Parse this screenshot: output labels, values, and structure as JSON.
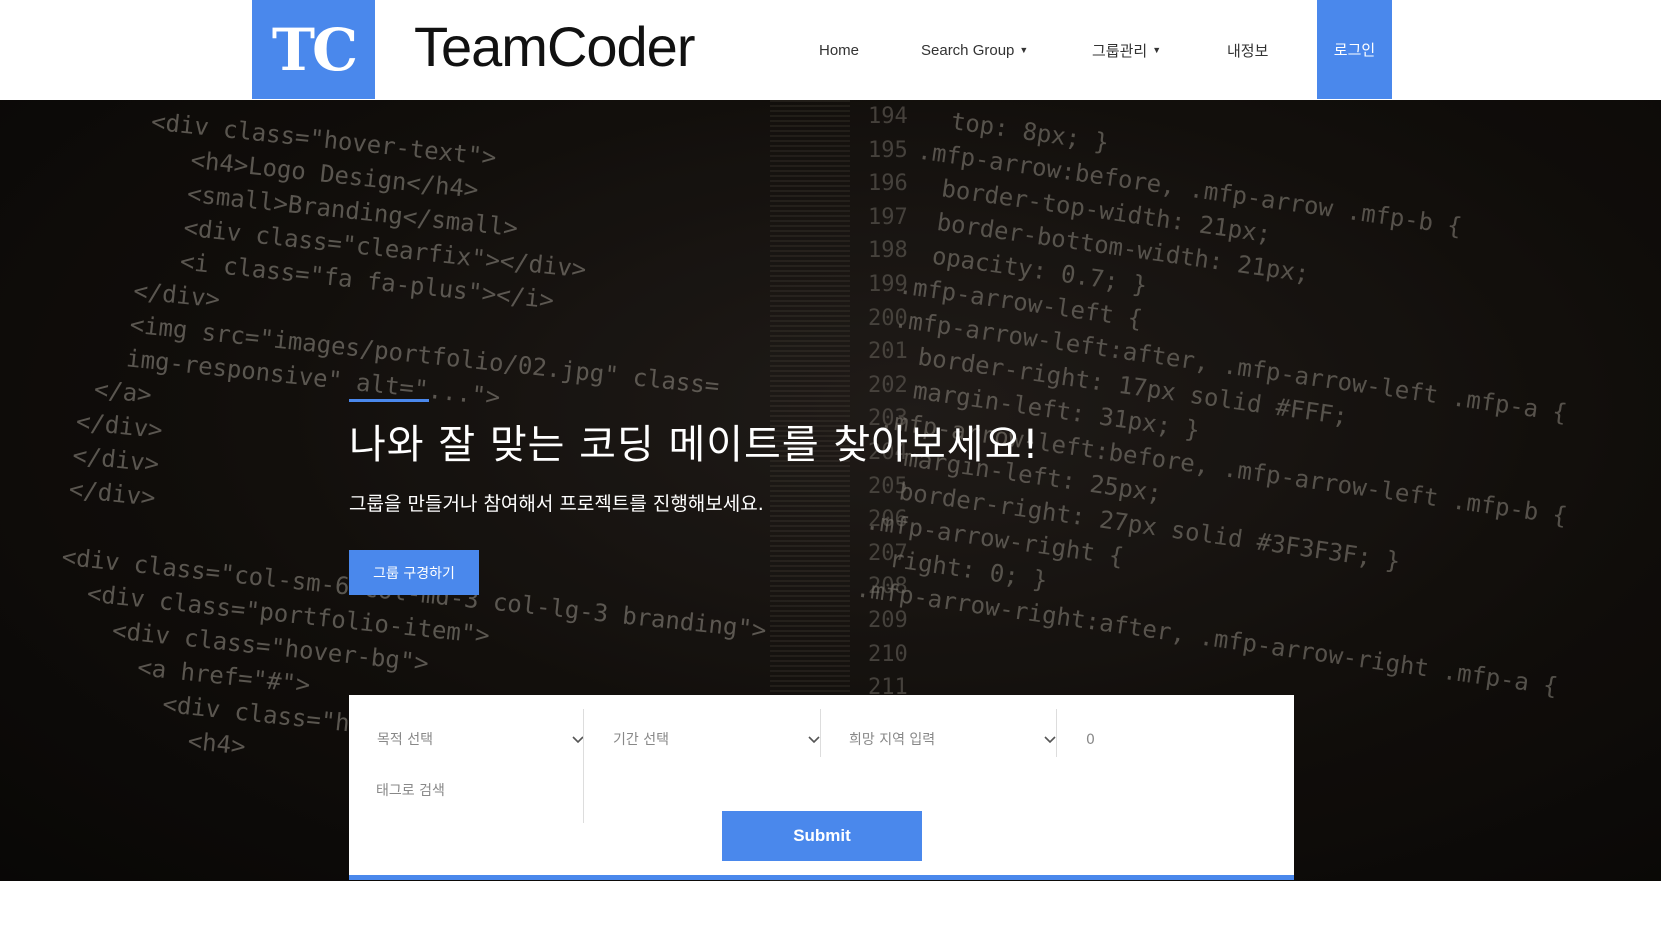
{
  "header": {
    "logo_text": "TC",
    "brand": "TeamCoder",
    "nav": {
      "home": "Home",
      "search_group": "Search Group",
      "group_manage": "그룹관리",
      "my_info": "내정보",
      "login": "로그인"
    }
  },
  "hero": {
    "title": "나와 잘 맞는 코딩 메이트를 찾아보세요!",
    "subtitle": "그룹을 만들거나 참여해서 프로젝트를 진행해보세요.",
    "cta": "그룹 구경하기"
  },
  "search": {
    "purpose_select": "목적 선택",
    "period_select": "기간 선택",
    "region_select": "희망 지역 입력",
    "number_value": "0",
    "tag_placeholder": "태그로 검색",
    "submit": "Submit"
  },
  "colors": {
    "accent": "#4a88ec"
  }
}
